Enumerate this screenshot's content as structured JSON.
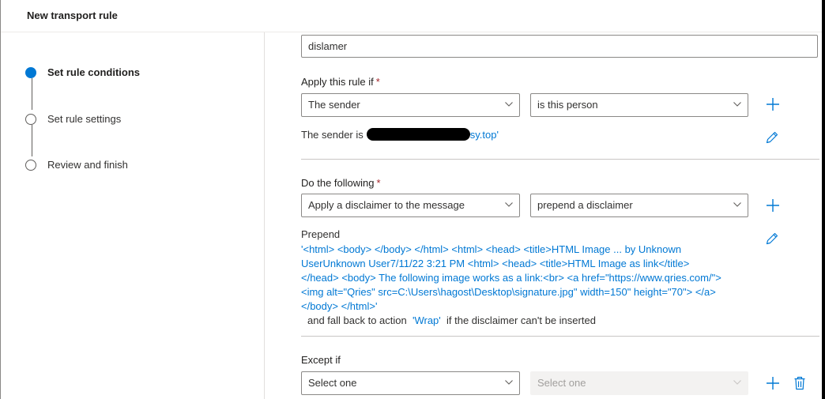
{
  "header": {
    "title": "New transport rule"
  },
  "steps": [
    {
      "label": "Set rule conditions",
      "state": "active"
    },
    {
      "label": "Set rule settings",
      "state": "inactive"
    },
    {
      "label": "Review and finish",
      "state": "inactive"
    }
  ],
  "rule_name": {
    "value": "dislamer"
  },
  "condition": {
    "label": "Apply this rule if",
    "required_mark": "*",
    "field1": "The sender",
    "field2": "is this person",
    "summary_prefix": "The sender is",
    "summary_value": "sy.top'"
  },
  "action": {
    "label": "Do the following",
    "required_mark": "*",
    "field1": "Apply a disclaimer to the message",
    "field2": "prepend a disclaimer",
    "summary_title": "Prepend",
    "disclaimer_lines": [
      "'<html> <body> </body> </html> <html> <head> <title>HTML Image ... by Unknown",
      "UserUnknown User7/11/22 3:21 PM <html> <head> <title>HTML Image as link</title>",
      "</head> <body> The following image works as a link:<br> <a href=\"https://www.qries.com/\">",
      "<img alt=\"Qries\" src=C:\\Users\\hagost\\Desktop\\signature.jpg\" width=150\" height=\"70\"> </a>",
      "</body> </html>'"
    ],
    "fallback_prefix": "and fall back to action",
    "fallback_value": "'Wrap'",
    "fallback_suffix": "if the disclaimer can't be inserted"
  },
  "exception": {
    "label": "Except if",
    "field1": "Select one",
    "field2": "Select one"
  },
  "colors": {
    "accent": "#0078d4",
    "required": "#a4262c"
  },
  "icons": {
    "add": "plus-icon",
    "edit": "pencil-icon",
    "delete": "trash-icon",
    "dropdown": "chevron-down-icon"
  }
}
